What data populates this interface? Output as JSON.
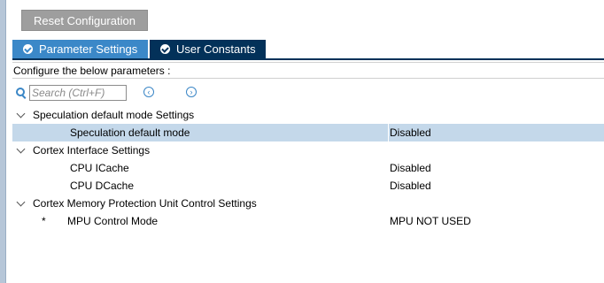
{
  "toolbar": {
    "reset_label": "Reset Configuration"
  },
  "tabs": [
    {
      "label": "Parameter Settings",
      "active": true,
      "icon": "check-circle-icon"
    },
    {
      "label": "User Constants",
      "active": false,
      "icon": "check-circle-icon"
    }
  ],
  "config_hint": "Configure the below parameters :",
  "search": {
    "placeholder": "Search (Ctrl+F)",
    "value": ""
  },
  "groups": [
    {
      "label": "Speculation default mode Settings",
      "params": [
        {
          "label": "Speculation default mode",
          "value": "Disabled",
          "selected": true
        }
      ]
    },
    {
      "label": "Cortex Interface Settings",
      "params": [
        {
          "label": "CPU ICache",
          "value": "Disabled"
        },
        {
          "label": "CPU DCache",
          "value": "Disabled"
        }
      ]
    },
    {
      "label": "Cortex Memory Protection Unit Control Settings",
      "params": [
        {
          "marker": "*",
          "label": "MPU Control Mode",
          "value": "MPU NOT USED"
        }
      ]
    }
  ],
  "colors": {
    "active_tab": "#3b88c8",
    "inactive_tab": "#033159",
    "selected_row": "#c4d8ea",
    "accent": "#3a86c6"
  }
}
